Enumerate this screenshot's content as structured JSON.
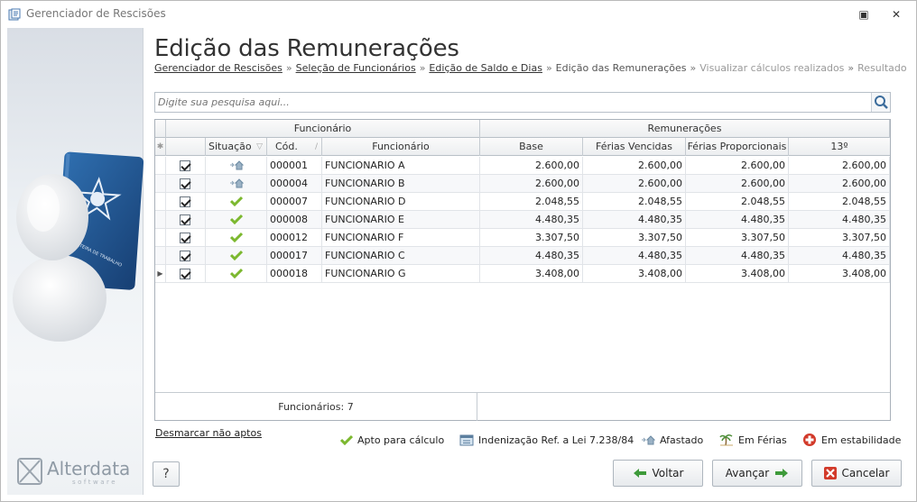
{
  "window": {
    "title": "Gerenciador de Rescisões",
    "restore_glyph": "▣",
    "close_glyph": "✕"
  },
  "page": {
    "title": "Edição das Remunerações"
  },
  "breadcrumb": {
    "items": [
      {
        "label": "Gerenciador de Rescisões",
        "state": "link"
      },
      {
        "label": "Seleção de Funcionários",
        "state": "link"
      },
      {
        "label": "Edição de Saldo e Dias",
        "state": "link"
      },
      {
        "label": "Edição das Remunerações",
        "state": "current"
      },
      {
        "label": "Visualizar cálculos realizados",
        "state": "disabled"
      },
      {
        "label": "Resultado",
        "state": "disabled"
      }
    ],
    "separator": "»"
  },
  "search": {
    "placeholder": "Digite sua pesquisa aqui..."
  },
  "grid": {
    "groups": {
      "funcionario": "Funcionário",
      "remuneracoes": "Remunerações"
    },
    "columns": {
      "situacao": "Situação",
      "cod": "Cód.",
      "funcionario": "Funcionário",
      "base": "Base",
      "ferias_vencidas": "Férias Vencidas",
      "ferias_proporcionais": "Férias Proporcionais",
      "decimo": "13º"
    },
    "rows": [
      {
        "checked": true,
        "status": "afastado",
        "cod": "000001",
        "nome": "FUNCIONARIO A",
        "base": "2.600,00",
        "fv": "2.600,00",
        "fp": "2.600,00",
        "d13": "2.600,00"
      },
      {
        "checked": true,
        "status": "afastado",
        "cod": "000004",
        "nome": "FUNCIONARIO B",
        "base": "2.600,00",
        "fv": "2.600,00",
        "fp": "2.600,00",
        "d13": "2.600,00"
      },
      {
        "checked": true,
        "status": "apto",
        "cod": "000007",
        "nome": "FUNCIONARIO D",
        "base": "2.048,55",
        "fv": "2.048,55",
        "fp": "2.048,55",
        "d13": "2.048,55"
      },
      {
        "checked": true,
        "status": "apto",
        "cod": "000008",
        "nome": "FUNCIONARIO E",
        "base": "4.480,35",
        "fv": "4.480,35",
        "fp": "4.480,35",
        "d13": "4.480,35"
      },
      {
        "checked": true,
        "status": "apto",
        "cod": "000012",
        "nome": "FUNCIONARIO F",
        "base": "3.307,50",
        "fv": "3.307,50",
        "fp": "3.307,50",
        "d13": "3.307,50"
      },
      {
        "checked": true,
        "status": "apto",
        "cod": "000017",
        "nome": "FUNCIONARIO C",
        "base": "4.480,35",
        "fv": "4.480,35",
        "fp": "4.480,35",
        "d13": "4.480,35"
      },
      {
        "checked": true,
        "status": "apto",
        "cod": "000018",
        "nome": "FUNCIONARIO G",
        "base": "3.408,00",
        "fv": "3.408,00",
        "fp": "3.408,00",
        "d13": "3.408,00"
      }
    ],
    "footer": {
      "count_label": "Funcionários: 7"
    }
  },
  "actions": {
    "unmark_label": "Desmarcar não aptos"
  },
  "legend": {
    "apto": "Apto para cálculo",
    "indenizacao": "Indenização Ref. a Lei 7.238/84",
    "afastado": "Afastado",
    "ferias": "Em Férias",
    "estabilidade": "Em estabilidade"
  },
  "buttons": {
    "help": "?",
    "voltar": "Voltar",
    "avancar": "Avançar",
    "cancelar": "Cancelar"
  },
  "sidebar": {
    "brand": "Alterdata",
    "brand_sub": "software",
    "card_text": "CARTEIRA DE TRABALHO"
  },
  "colors": {
    "accent_green": "#7cb82f",
    "cancel_red": "#d23a2a",
    "arrow_green": "#3e9a3a"
  }
}
